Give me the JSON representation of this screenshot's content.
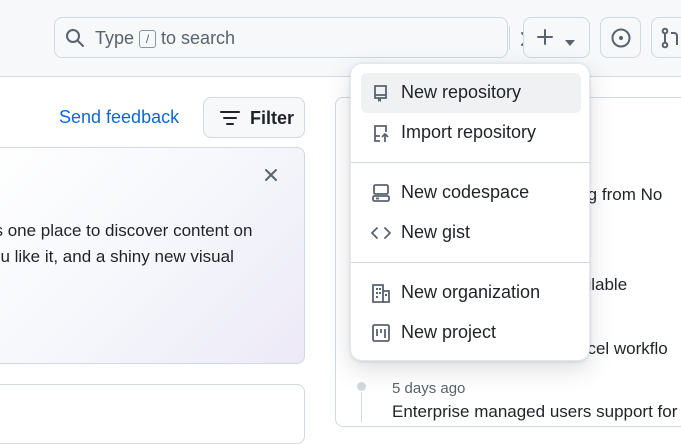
{
  "header": {
    "search_prefix": "Type",
    "search_key": "/",
    "search_suffix": "to search"
  },
  "left": {
    "feedback_label": "Send feedback",
    "filter_label": "Filter",
    "card_line1": "’s one place to discover content on",
    "card_line2": "ou like it, and a shiny new visual"
  },
  "right": {
    "line1": "ning from No",
    "line2": "ailable",
    "line3": "ncel workflo",
    "date": "5 days ago",
    "entry": "Enterprise managed users support for"
  },
  "menu": {
    "items": [
      {
        "label": "New repository",
        "icon": "repo-icon"
      },
      {
        "label": "Import repository",
        "icon": "repo-push-icon"
      },
      {
        "label": "New codespace",
        "icon": "codespaces-icon"
      },
      {
        "label": "New gist",
        "icon": "code-icon"
      },
      {
        "label": "New organization",
        "icon": "organization-icon"
      },
      {
        "label": "New project",
        "icon": "project-icon"
      }
    ]
  },
  "colors": {
    "accent": "#0969da",
    "text": "#1f2328",
    "muted": "#59636e",
    "border": "#d1d9e0"
  }
}
